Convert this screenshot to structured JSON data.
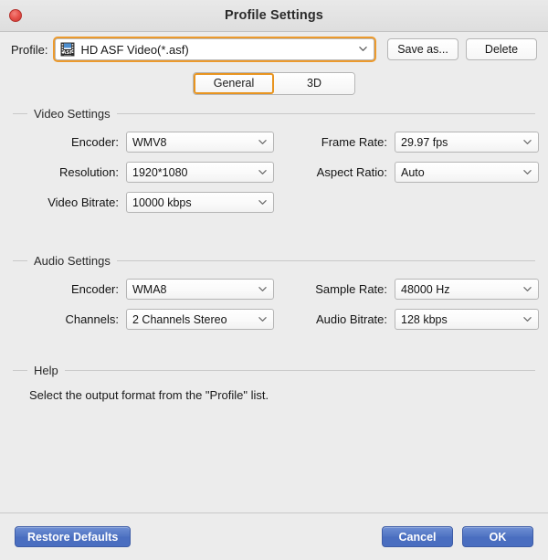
{
  "window": {
    "title": "Profile Settings",
    "close_icon": "close-icon"
  },
  "profile_bar": {
    "label": "Profile:",
    "value": "HD ASF Video(*.asf)",
    "format_icon": "video-file-icon",
    "dropdown_icon": "chevron-down-icon",
    "save_as_label": "Save as...",
    "delete_label": "Delete"
  },
  "tabs": [
    {
      "label": "General",
      "active": true
    },
    {
      "label": "3D",
      "active": false
    }
  ],
  "video_settings": {
    "title": "Video Settings",
    "fields": [
      {
        "label": "Encoder:",
        "value": "WMV8"
      },
      {
        "label": "Frame Rate:",
        "value": "29.97 fps"
      },
      {
        "label": "Resolution:",
        "value": "1920*1080"
      },
      {
        "label": "Aspect Ratio:",
        "value": "Auto"
      },
      {
        "label": "Video Bitrate:",
        "value": "10000 kbps"
      }
    ]
  },
  "audio_settings": {
    "title": "Audio Settings",
    "fields": [
      {
        "label": "Encoder:",
        "value": "WMA8"
      },
      {
        "label": "Sample Rate:",
        "value": "48000 Hz"
      },
      {
        "label": "Channels:",
        "value": "2 Channels Stereo"
      },
      {
        "label": "Audio Bitrate:",
        "value": "128 kbps"
      }
    ]
  },
  "help": {
    "title": "Help",
    "text": "Select the output format from the \"Profile\" list."
  },
  "footer": {
    "restore_label": "Restore Defaults",
    "cancel_label": "Cancel",
    "ok_label": "OK"
  },
  "colors": {
    "accent_focus": "#e8941f",
    "button_blue": "#4a6ec0",
    "window_bg": "#ececec",
    "close_red": "#e8534c"
  }
}
